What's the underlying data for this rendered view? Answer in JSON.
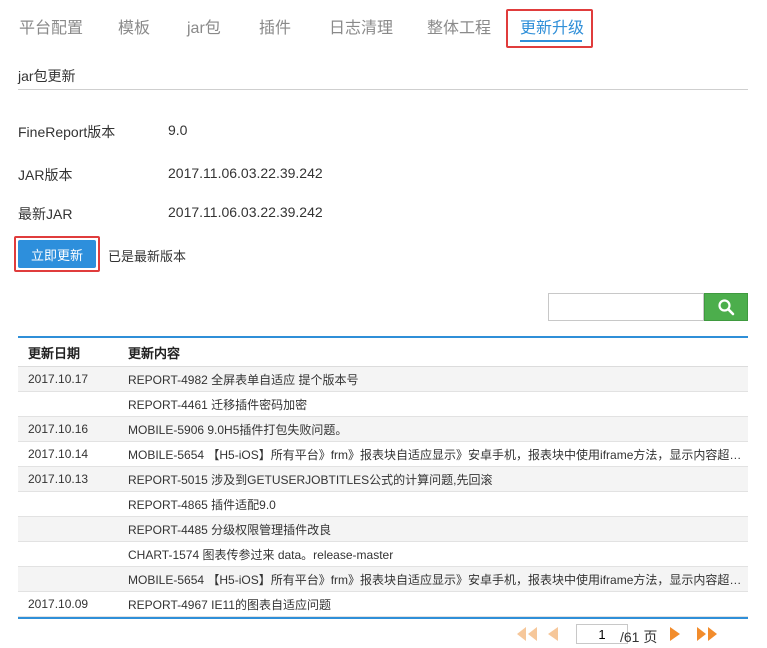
{
  "tabs": [
    {
      "label": "平台配置",
      "active": false
    },
    {
      "label": "模板",
      "active": false
    },
    {
      "label": "jar包",
      "active": false
    },
    {
      "label": "插件",
      "active": false
    },
    {
      "label": "日志清理",
      "active": false
    },
    {
      "label": "整体工程",
      "active": false
    },
    {
      "label": "更新升级",
      "active": true
    }
  ],
  "section": {
    "title": "jar包更新"
  },
  "info": {
    "finereport_label": "FineReport版本",
    "finereport_value": "9.0",
    "jar_label": "JAR版本",
    "jar_value": "2017.11.06.03.22.39.242",
    "latest_label": "最新JAR",
    "latest_value": "2017.11.06.03.22.39.242"
  },
  "update": {
    "button_label": "立即更新",
    "status": "已是最新版本"
  },
  "search": {
    "value": "",
    "placeholder": ""
  },
  "table": {
    "headers": {
      "date": "更新日期",
      "content": "更新内容"
    },
    "rows": [
      {
        "date": "2017.10.17",
        "content": "REPORT-4982 全屏表单自适应 提个版本号"
      },
      {
        "date": "",
        "content": "REPORT-4461 迁移插件密码加密"
      },
      {
        "date": "2017.10.16",
        "content": "MOBILE-5906 9.0H5插件打包失败问题。"
      },
      {
        "date": "2017.10.14",
        "content": "MOBILE-5654 【H5-iOS】所有平台》frm》报表块自适应显示》安卓手机，报表块中使用iframe方法，显示内容超出..."
      },
      {
        "date": "2017.10.13",
        "content": "REPORT-5015 涉及到GETUSERJOBTITLES公式的计算问题,先回滚"
      },
      {
        "date": "",
        "content": "REPORT-4865 插件适配9.0"
      },
      {
        "date": "",
        "content": "REPORT-4485 分级权限管理插件改良"
      },
      {
        "date": "",
        "content": "CHART-1574 图表传参过来 data。release-master"
      },
      {
        "date": "",
        "content": "MOBILE-5654 【H5-iOS】所有平台》frm》报表块自适应显示》安卓手机，报表块中使用iframe方法，显示内容超出..."
      },
      {
        "date": "2017.10.09",
        "content": "REPORT-4967 IE11的图表自适应问题"
      }
    ]
  },
  "pagination": {
    "current_page": "1",
    "total_label": "/61 页"
  },
  "colors": {
    "accent": "#2f8fd8",
    "highlight": "#e03c3c",
    "search_button": "#4cae4c",
    "pager_arrow": "#f28c2c"
  }
}
